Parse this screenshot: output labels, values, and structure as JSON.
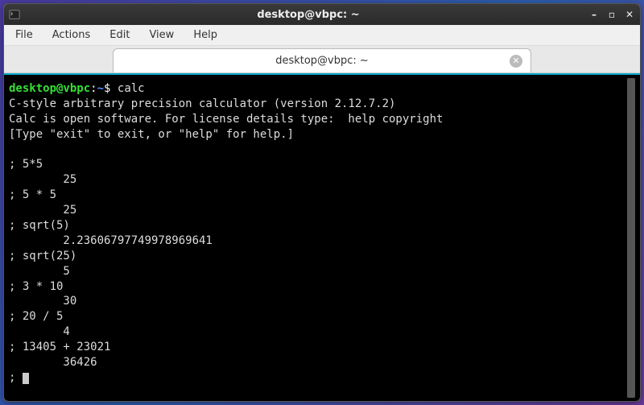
{
  "titlebar": {
    "title": "desktop@vbpc: ~"
  },
  "menubar": {
    "file": "File",
    "actions": "Actions",
    "edit": "Edit",
    "view": "View",
    "help": "Help"
  },
  "tab": {
    "label": "desktop@vbpc: ~"
  },
  "prompt": {
    "userhost": "desktop@vbpc",
    "colon": ":",
    "path": "~",
    "dollar": "$ "
  },
  "command": "calc",
  "calc": {
    "header1": "C-style arbitrary precision calculator (version 2.12.7.2)",
    "header2": "Calc is open software. For license details type:  help copyright",
    "header3": "[Type \"exit\" to exit, or \"help\" for help.]",
    "blank": "",
    "l1": "; 5*5",
    "r1": "        25",
    "l2": "; 5 * 5",
    "r2": "        25",
    "l3": "; sqrt(5)",
    "r3": "        2.23606797749978969641",
    "l4": "; sqrt(25)",
    "r4": "        5",
    "l5": "; 3 * 10",
    "r5": "        30",
    "l6": "; 20 / 5",
    "r6": "        4",
    "l7": "; 13405 + 23021",
    "r7": "        36426",
    "promptline": "; "
  }
}
